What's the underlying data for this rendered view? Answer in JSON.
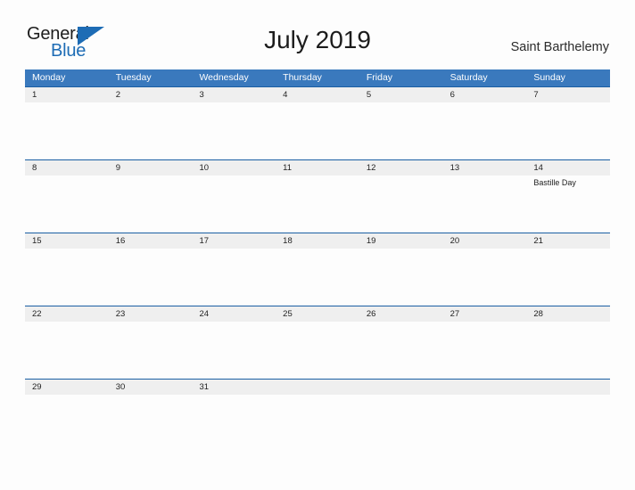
{
  "logo": {
    "text_primary": "General",
    "text_secondary": "Blue",
    "mark_icon": "triangle-flag-icon",
    "accent_color": "#1d6cb5"
  },
  "header": {
    "title": "July 2019",
    "region": "Saint Barthelemy"
  },
  "theme": {
    "header_blue": "#3a79bd",
    "date_band_gray": "#efefef",
    "week_rule_blue": "#1a5fa3",
    "page_background": "#fdfdfd",
    "text_dark": "#1c1c1c"
  },
  "calendar": {
    "day_headers": [
      "Monday",
      "Tuesday",
      "Wednesday",
      "Thursday",
      "Friday",
      "Saturday",
      "Sunday"
    ],
    "weeks": [
      {
        "days": [
          {
            "date": "1",
            "events": []
          },
          {
            "date": "2",
            "events": []
          },
          {
            "date": "3",
            "events": []
          },
          {
            "date": "4",
            "events": []
          },
          {
            "date": "5",
            "events": []
          },
          {
            "date": "6",
            "events": []
          },
          {
            "date": "7",
            "events": []
          }
        ]
      },
      {
        "days": [
          {
            "date": "8",
            "events": []
          },
          {
            "date": "9",
            "events": []
          },
          {
            "date": "10",
            "events": []
          },
          {
            "date": "11",
            "events": []
          },
          {
            "date": "12",
            "events": []
          },
          {
            "date": "13",
            "events": []
          },
          {
            "date": "14",
            "events": [
              "Bastille Day"
            ]
          }
        ]
      },
      {
        "days": [
          {
            "date": "15",
            "events": []
          },
          {
            "date": "16",
            "events": []
          },
          {
            "date": "17",
            "events": []
          },
          {
            "date": "18",
            "events": []
          },
          {
            "date": "19",
            "events": []
          },
          {
            "date": "20",
            "events": []
          },
          {
            "date": "21",
            "events": []
          }
        ]
      },
      {
        "days": [
          {
            "date": "22",
            "events": []
          },
          {
            "date": "23",
            "events": []
          },
          {
            "date": "24",
            "events": []
          },
          {
            "date": "25",
            "events": []
          },
          {
            "date": "26",
            "events": []
          },
          {
            "date": "27",
            "events": []
          },
          {
            "date": "28",
            "events": []
          }
        ]
      },
      {
        "days": [
          {
            "date": "29",
            "events": []
          },
          {
            "date": "30",
            "events": []
          },
          {
            "date": "31",
            "events": []
          },
          {
            "date": "",
            "events": []
          },
          {
            "date": "",
            "events": []
          },
          {
            "date": "",
            "events": []
          },
          {
            "date": "",
            "events": []
          }
        ]
      }
    ]
  }
}
